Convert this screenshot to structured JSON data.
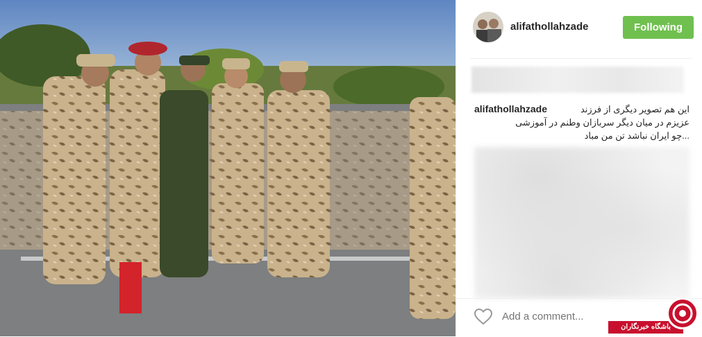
{
  "post": {
    "image_alt": "Group of soldiers in camouflage uniforms",
    "username": "alifathollahzade",
    "follow_label": "Following",
    "caption_user": "alifathollahzade",
    "caption_lines": [
      "این هم تصویر دیگری از فرزند",
      "عزیزم در میان دیگر سربازان وطنم در آموزشی",
      "...چو ایران نباشد تن من مباد"
    ]
  },
  "comment": {
    "placeholder": "Add a comment..."
  },
  "watermark": {
    "label": "باشگاه خبرنگاران"
  },
  "colors": {
    "follow_green": "#70c050",
    "watermark_red": "#c8102e"
  },
  "icons": [
    "heart-icon",
    "avatar",
    "watermark-logo"
  ]
}
